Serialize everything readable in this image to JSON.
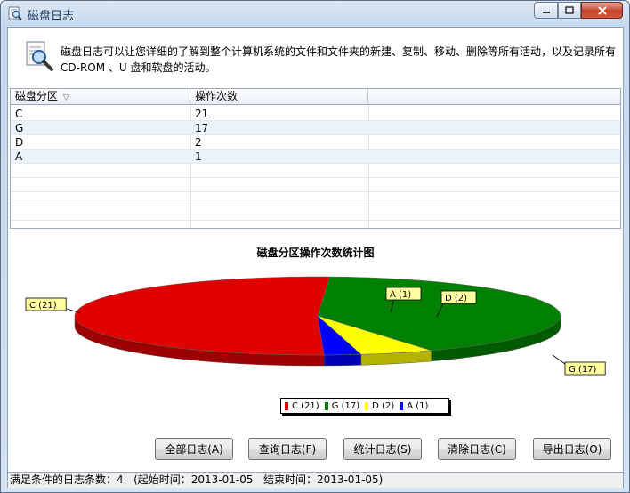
{
  "window": {
    "title": "磁盘日志"
  },
  "info": {
    "text": "磁盘日志可以让您详细的了解到整个计算机系统的文件和文件夹的新建、复制、移动、删除等所有活动，以及记录所有 CD-ROM 、U 盘和软盘的活动。"
  },
  "table": {
    "columns": [
      "磁盘分区",
      "操作次数"
    ],
    "rows": [
      {
        "partition": "C",
        "count": "21"
      },
      {
        "partition": "G",
        "count": "17"
      },
      {
        "partition": "D",
        "count": "2"
      },
      {
        "partition": "A",
        "count": "1"
      }
    ]
  },
  "chart_data": {
    "type": "pie",
    "title": "磁盘分区操作次数统计图",
    "labels": [
      "C",
      "G",
      "D",
      "A"
    ],
    "values": [
      21,
      17,
      2,
      1
    ],
    "slice_labels": [
      "C (21)",
      "G (17)",
      "D (2)",
      "A (1)"
    ],
    "legend": [
      "C (21)",
      "G (17)",
      "D (2)",
      "A (1)"
    ],
    "colors": [
      "#e00000",
      "#008000",
      "#ffff00",
      "#0000ff"
    ],
    "legend_position": "bottom"
  },
  "buttons": {
    "all": "全部日志(A)",
    "query": "查询日志(F)",
    "stats": "统计日志(S)",
    "clear": "清除日志(C)",
    "export": "导出日志(O)"
  },
  "status": {
    "text": "满足条件的日志条数：4   (起始时间：2013-01-05   结束时间：2013-01-05)"
  }
}
